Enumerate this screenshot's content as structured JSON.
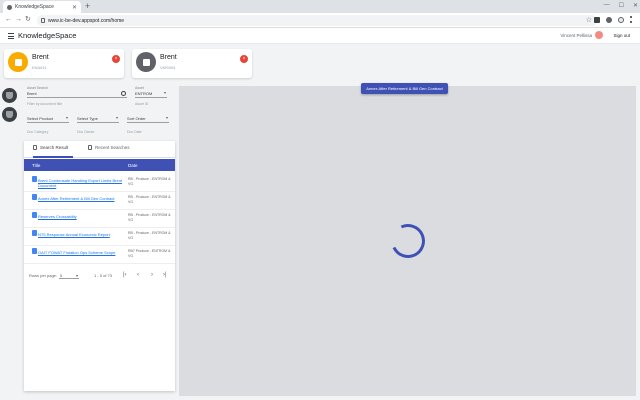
{
  "browser": {
    "tab_title": "KnowledgeSpace",
    "url": "www.ic-be-dev.appspot.com/home"
  },
  "app": {
    "title": "KnowledgeSpace",
    "user_name": "Vincent Pellissa",
    "signout_label": "Sign out"
  },
  "cards": [
    {
      "name": "Brent",
      "sub": "ENA611",
      "color": "#f9ab00"
    },
    {
      "name": "Brent",
      "sub": "VMS904",
      "color": "#5f6368"
    }
  ],
  "filters": {
    "search_label": "Asset Search",
    "search_value": "Brent",
    "asset_label": "Asset",
    "asset_value": "ENTROM",
    "hint1": "Filter by document title",
    "hint2": "Asset ID",
    "dropdown1": "Select Product",
    "dropdown2": "Select Type",
    "dropdown3": "Sort Order",
    "small1": "Doc Category",
    "small2": "Doc Owner",
    "small3": "Doc Date"
  },
  "panel": {
    "tab_active": "Search Result",
    "tab_other": "Recent Searches",
    "col_title": "Title",
    "col_date": "Date",
    "rows": [
      {
        "title": "Brent Condensate Handling Export Limits Brent Document",
        "date": "RB - Produce - ENTROM & VG"
      },
      {
        "title": "Annex After Retirement & Bill Gen Contract",
        "date": "RB - Produce - ENTROM & VG"
      },
      {
        "title": "Reserves Crossability",
        "date": "RB - Produce - ENTROM & VG"
      },
      {
        "title": "NT5 Response Annual Economic Report",
        "date": "RB - Produce - ENTROM & VG"
      },
      {
        "title": "OAIT FOWAT Flotation Ops Scheme Scope",
        "date": "RB7 Produce - ENTROM & VG"
      }
    ],
    "rows_per_page_label": "Rows per page:",
    "rows_per_page": "5",
    "range": "1 - 5 of 73"
  },
  "viewer": {
    "chip": "Annex After Retirement & Bill Gen Contract"
  }
}
